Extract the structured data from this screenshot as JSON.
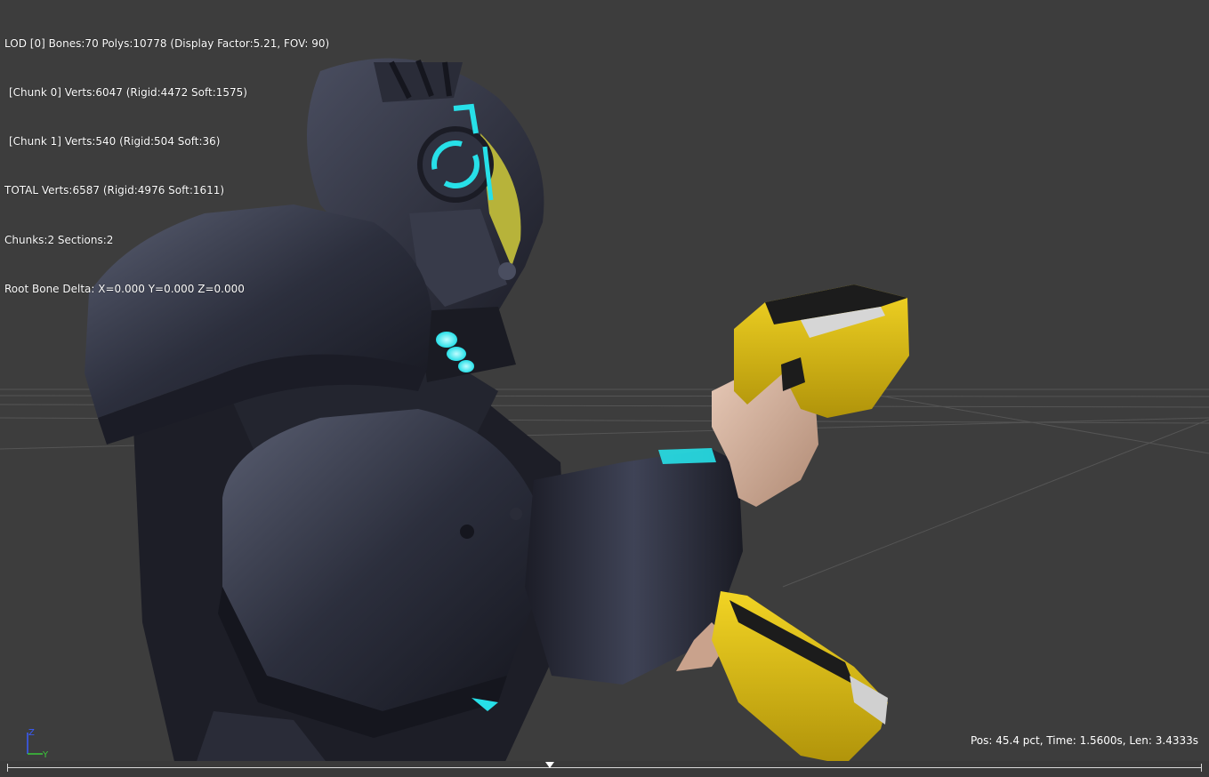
{
  "stats": {
    "lines": [
      "LOD [0] Bones:70 Polys:10778 (Display Factor:5.21, FOV: 90)",
      "[Chunk 0] Verts:6047 (Rigid:4472 Soft:1575)",
      "[Chunk 1] Verts:540 (Rigid:504 Soft:36)",
      "TOTAL Verts:6587 (Rigid:4976 Soft:1611)",
      "Chunks:2 Sections:2",
      "Root Bone Delta: X=0.000 Y=0.000 Z=0.000"
    ]
  },
  "playback": {
    "status": "Pos: 45.4 pct, Time: 1.5600s, Len: 3.4333s",
    "position_fraction": 0.454
  },
  "axis": {
    "z_label": "Z",
    "y_label": "Y"
  },
  "colors": {
    "background": "#3d3d3d",
    "armor": "#2a2d3a",
    "glow": "#27e0e8",
    "gun_yellow": "#d8b80e",
    "axis_z": "#3a5cff",
    "axis_y": "#3ac83a"
  },
  "scene": {
    "description_icon": "character-model"
  }
}
